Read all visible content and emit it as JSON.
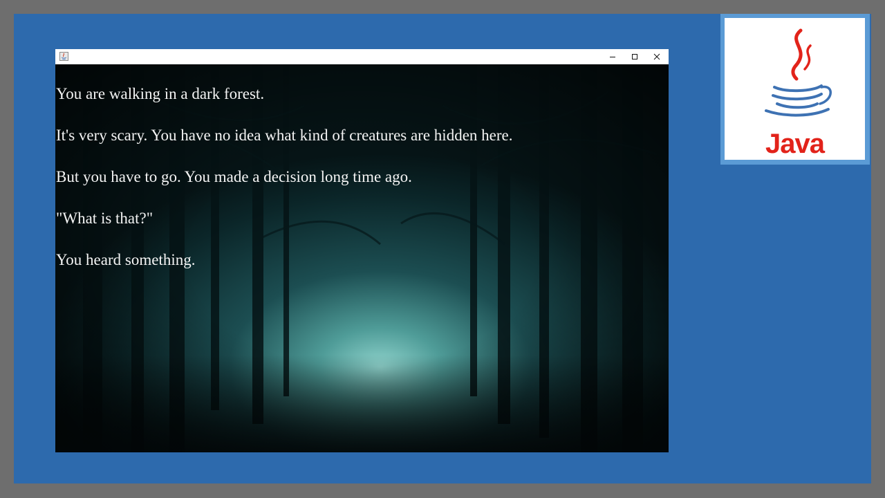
{
  "window": {
    "title": "",
    "controls": {
      "minimize": "minimize-icon",
      "maximize": "maximize-icon",
      "close": "close-icon"
    }
  },
  "story": {
    "lines": [
      "You are walking in a dark forest.",
      "It's very scary. You have no idea what kind of creatures are hidden here.",
      "But you have to go. You made a decision long time ago.",
      "\"What is that?\"",
      "You heard something."
    ]
  },
  "logo": {
    "text": "Java",
    "icon": "java-cup-icon"
  },
  "colors": {
    "stage": "#2d6aad",
    "frame": "#6e6e6e",
    "logo_border": "#5b9bd5",
    "java_red": "#e2231a",
    "java_blue": "#3e72b3"
  }
}
